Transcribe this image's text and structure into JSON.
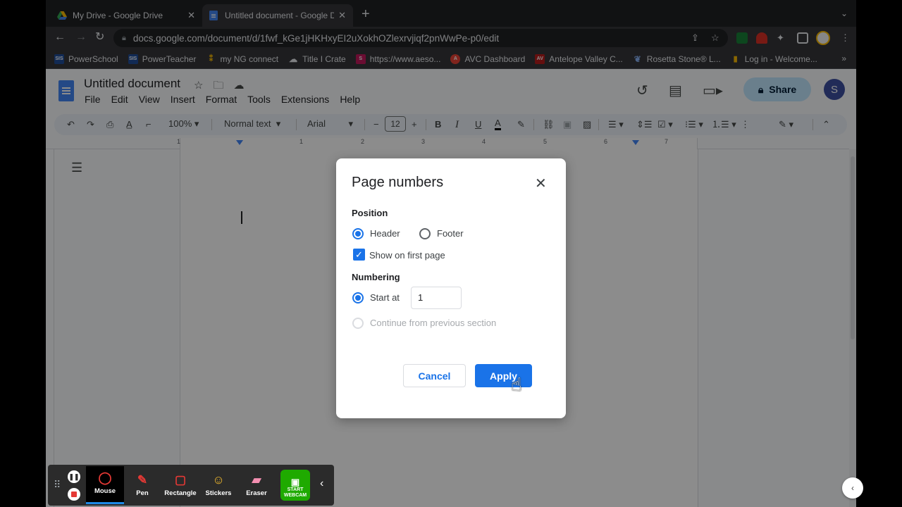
{
  "browser": {
    "tabs": [
      {
        "title": "My Drive - Google Drive",
        "icon": "google-drive-icon",
        "active": false
      },
      {
        "title": "Untitled document - Google Docs",
        "icon": "google-docs-icon",
        "active": true
      }
    ],
    "url": "docs.google.com/document/d/1fwf_kGe1jHKHxyEI2uXokhOZlexrvjiqf2pnWwPe-p0/edit",
    "bookmarks": [
      {
        "label": "PowerSchool",
        "icon": "sis-icon"
      },
      {
        "label": "PowerTeacher",
        "icon": "sis-icon"
      },
      {
        "label": "my NG connect",
        "icon": "ngconnect-icon"
      },
      {
        "label": "Title I Crate",
        "icon": "cloud-icon"
      },
      {
        "label": "https://www.aeso...",
        "icon": "aeso-icon"
      },
      {
        "label": "AVC Dashboard",
        "icon": "avc-icon"
      },
      {
        "label": "Antelope Valley C...",
        "icon": "av-icon"
      },
      {
        "label": "Rosetta Stone® L...",
        "icon": "rosetta-icon"
      },
      {
        "label": "Log in - Welcome...",
        "icon": "chart-icon"
      }
    ],
    "bookmarks_more": "»"
  },
  "docs": {
    "title": "Untitled document",
    "menu": [
      "File",
      "Edit",
      "View",
      "Insert",
      "Format",
      "Tools",
      "Extensions",
      "Help"
    ],
    "share_label": "Share",
    "avatar_initial": "S",
    "toolbar": {
      "zoom": "100%",
      "style": "Normal text",
      "font": "Arial",
      "font_size": "12"
    },
    "ruler_numbers": [
      "1",
      "1",
      "2",
      "3",
      "4",
      "5",
      "6",
      "7"
    ]
  },
  "dialog": {
    "title": "Page numbers",
    "position_label": "Position",
    "header_label": "Header",
    "footer_label": "Footer",
    "show_first_label": "Show on first page",
    "numbering_label": "Numbering",
    "start_at_label": "Start at",
    "start_at_value": "1",
    "continue_label": "Continue from previous section",
    "cancel_label": "Cancel",
    "apply_label": "Apply"
  },
  "annotation_bar": {
    "tools": [
      {
        "label": "Mouse",
        "icon": "mouse-icon"
      },
      {
        "label": "Pen",
        "icon": "pen-icon"
      },
      {
        "label": "Rectangle",
        "icon": "rectangle-icon"
      },
      {
        "label": "Stickers",
        "icon": "sticker-icon"
      },
      {
        "label": "Eraser",
        "icon": "eraser-icon"
      }
    ],
    "webcam_label": "START WEBCAM"
  }
}
